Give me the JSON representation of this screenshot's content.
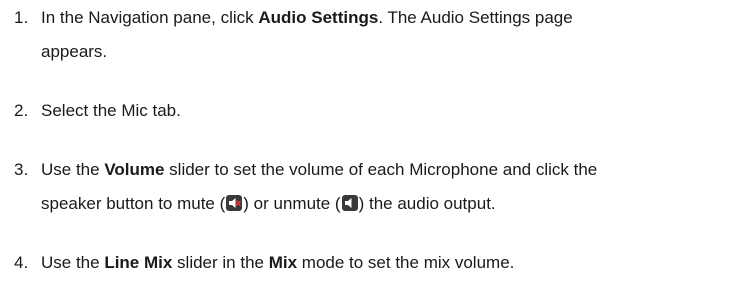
{
  "steps": [
    {
      "number": "1.",
      "line1_pre": "In the Navigation pane, click ",
      "line1_bold": "Audio Settings",
      "line1_post": ". The Audio Settings page",
      "line2": "appears."
    },
    {
      "number": "2.",
      "text": "Select the Mic tab."
    },
    {
      "number": "3.",
      "line1_pre": "Use the ",
      "line1_bold": "Volume",
      "line1_post": " slider to set the volume of each Microphone and click the",
      "line2_pre": "speaker button to mute (",
      "mute_icon": "speaker-muted-icon",
      "line2_mid": ") or unmute (",
      "unmute_icon": "speaker-icon",
      "line2_post": ") the audio output."
    },
    {
      "number": "4.",
      "pre": "Use the ",
      "bold1": "Line Mix",
      "mid": " slider in the ",
      "bold2": "Mix",
      "post": " mode to set the mix volume."
    }
  ],
  "colors": {
    "text": "#1a1a1a",
    "icon_bg": "#3a3a3a",
    "mute_x": "#d23c3c"
  }
}
